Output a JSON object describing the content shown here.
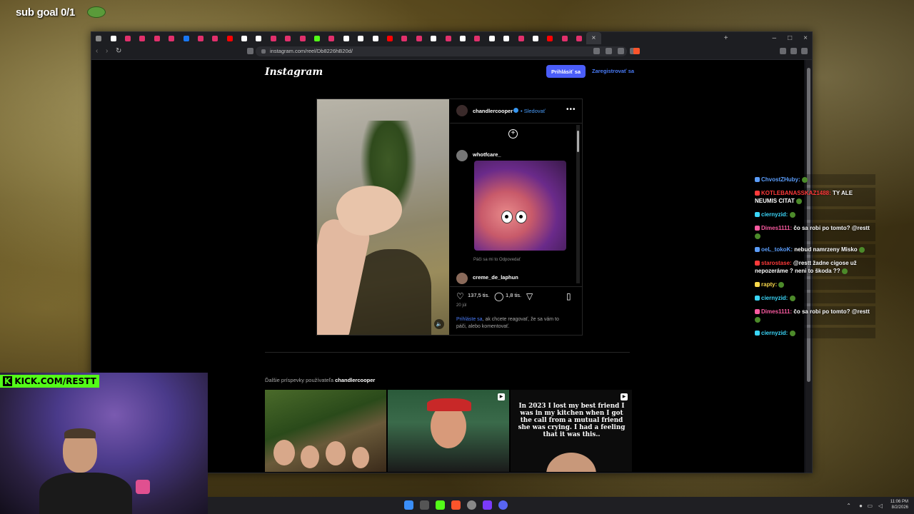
{
  "overlay": {
    "sub_goal": "sub goal 0/1",
    "kick_prefix": "K",
    "kick_url": "KICK.COM/RESTT"
  },
  "browser": {
    "url": "instagram.com/reel/Db8226hB20d/",
    "tab_favicon_colors": [
      "#888",
      "#fff",
      "#e1306c",
      "#e1306c",
      "#e1306c",
      "#e1306c",
      "#1877f2",
      "#e1306c",
      "#e1306c",
      "#ff0000",
      "#fff",
      "#fff",
      "#e1306c",
      "#e1306c",
      "#e1306c",
      "#53fc18",
      "#e1306c",
      "#fff",
      "#fff",
      "#fff",
      "#ff0000",
      "#e1306c",
      "#e1306c",
      "#fff",
      "#e1306c",
      "#fff",
      "#e1306c",
      "#fff",
      "#fff",
      "#e1306c",
      "#fff",
      "#ff0000",
      "#e1306c",
      "#e1306c"
    ],
    "close_tab_label": "×",
    "new_tab_label": "+",
    "minimize_label": "–",
    "maximize_label": "□",
    "close_label": "×"
  },
  "instagram": {
    "logo": "Instagram",
    "login_button": "Prihlásiť sa",
    "register_link": "Zaregistrovať sa",
    "author": "chandlercooper",
    "follow": "• Sledovať",
    "more": "•••",
    "comments": [
      {
        "user": "whotfcare_"
      },
      {
        "user": "creme_de_laphun"
      }
    ],
    "comment_meta": "Páči sa mi to    Odpovedať",
    "likes": "137,5 tis.",
    "comment_count": "1,8 tis.",
    "date": "20 júl",
    "login_note_link": "Prihláste sa",
    "login_note_text": ", ak chcete reagovať, že sa vám to páči, alebo komentovať.",
    "more_posts_prefix": "Ďalšie príspevky používateľa ",
    "more_posts_user": "chandlercooper",
    "post3_text": "In 2023 I lost my best friend I was in my kitchen when I got the call from a mutual friend she was crying. I had a feeling that it was this.."
  },
  "chat": [
    {
      "user": "ChvostZHuby:",
      "text": "",
      "color": "#5a9cf9"
    },
    {
      "user": "KOTLEBANASSKAZ1488:",
      "text": " TY ALE NEUMIS CITAT",
      "color": "#ff3a3a"
    },
    {
      "user": "ciernyzid:",
      "text": "",
      "color": "#3ad6f9"
    },
    {
      "user": "Dimes1111:",
      "text": " čo sa robi po tomto? @restt",
      "color": "#f95aa0"
    },
    {
      "user": "oeL_tokoK:",
      "text": " nebud namrzeny Misko",
      "color": "#5a9cf9"
    },
    {
      "user": "starostase:",
      "text": " @restt žadne cigose už nepozeráme ? neni to škoda ??",
      "color": "#ff3a3a"
    },
    {
      "user": "rapty:",
      "text": "",
      "color": "#f9d84a"
    },
    {
      "user": "ciernyzid:",
      "text": "",
      "color": "#3ad6f9"
    },
    {
      "user": "Dimes1111:",
      "text": " čo sa robi po tomto? @restt",
      "color": "#f95aa0"
    },
    {
      "user": "ciernyzid:",
      "text": "",
      "color": "#3ad6f9"
    }
  ],
  "taskbar": {
    "time": "11:06 PM",
    "date": "8/2/2026"
  }
}
